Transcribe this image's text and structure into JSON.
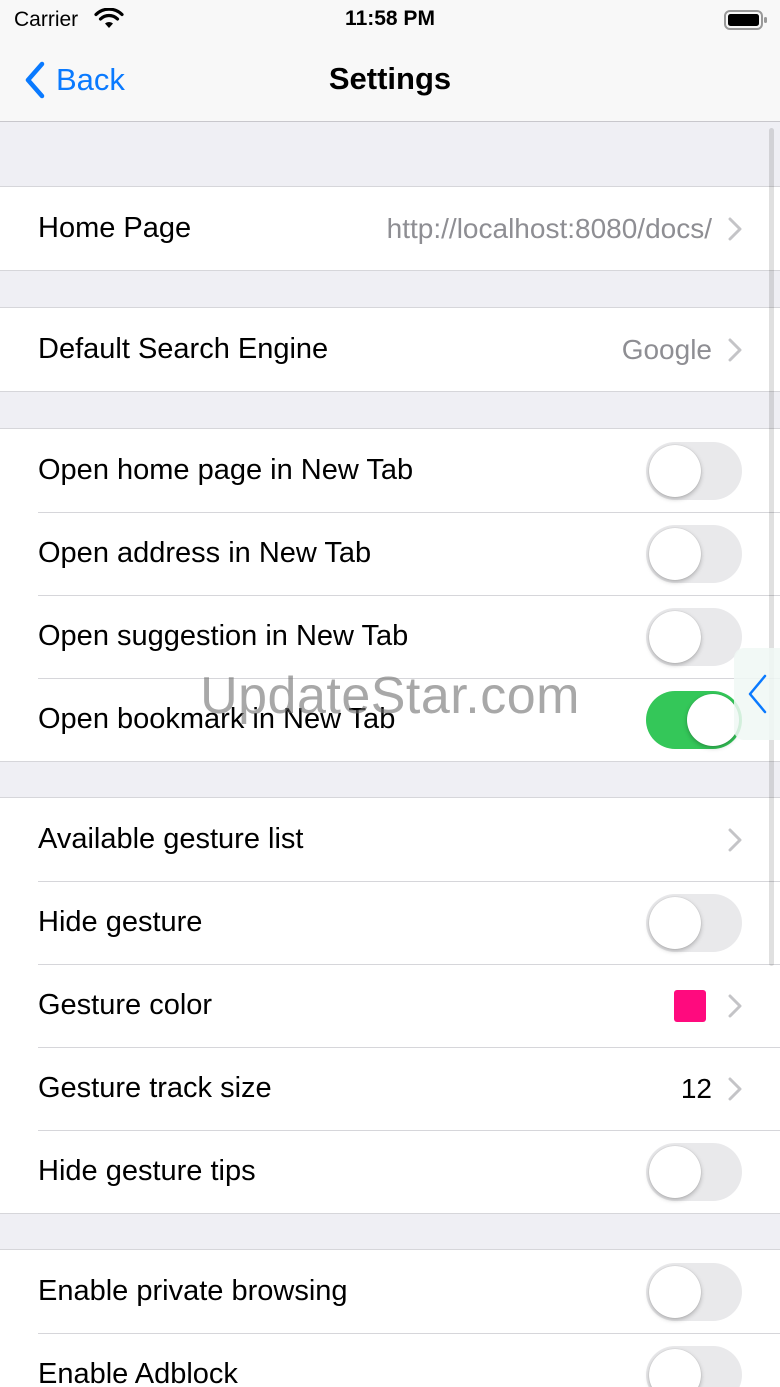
{
  "status_bar": {
    "carrier": "Carrier",
    "time": "11:58 PM"
  },
  "nav": {
    "back_label": "Back",
    "title": "Settings"
  },
  "colors": {
    "accent": "#0a7aff",
    "toggle_on": "#34c759",
    "gesture_color": "#ff0a7e"
  },
  "groups": [
    {
      "rows": [
        {
          "label": "Home Page",
          "value": "http://localhost:8080/docs/",
          "accessory": "chevron"
        }
      ]
    },
    {
      "rows": [
        {
          "label": "Default Search Engine",
          "value": "Google",
          "accessory": "chevron"
        }
      ]
    },
    {
      "rows": [
        {
          "label": "Open home page in New Tab",
          "accessory": "toggle",
          "on": false
        },
        {
          "label": "Open address in New Tab",
          "accessory": "toggle",
          "on": false
        },
        {
          "label": "Open suggestion in New Tab",
          "accessory": "toggle",
          "on": false
        },
        {
          "label": "Open bookmark in New Tab",
          "accessory": "toggle",
          "on": true
        }
      ]
    },
    {
      "rows": [
        {
          "label": "Available gesture list",
          "accessory": "chevron"
        },
        {
          "label": "Hide gesture",
          "accessory": "toggle",
          "on": false
        },
        {
          "label": "Gesture color",
          "accessory": "color-swatch-chevron"
        },
        {
          "label": "Gesture track size",
          "value": "12",
          "accessory": "chevron"
        },
        {
          "label": "Hide gesture tips",
          "accessory": "toggle",
          "on": false
        }
      ]
    },
    {
      "rows": [
        {
          "label": "Enable private browsing",
          "accessory": "toggle",
          "on": false
        },
        {
          "label": "Enable Adblock",
          "accessory": "toggle",
          "on": false
        }
      ]
    }
  ],
  "watermark": "UpdateStar.com"
}
